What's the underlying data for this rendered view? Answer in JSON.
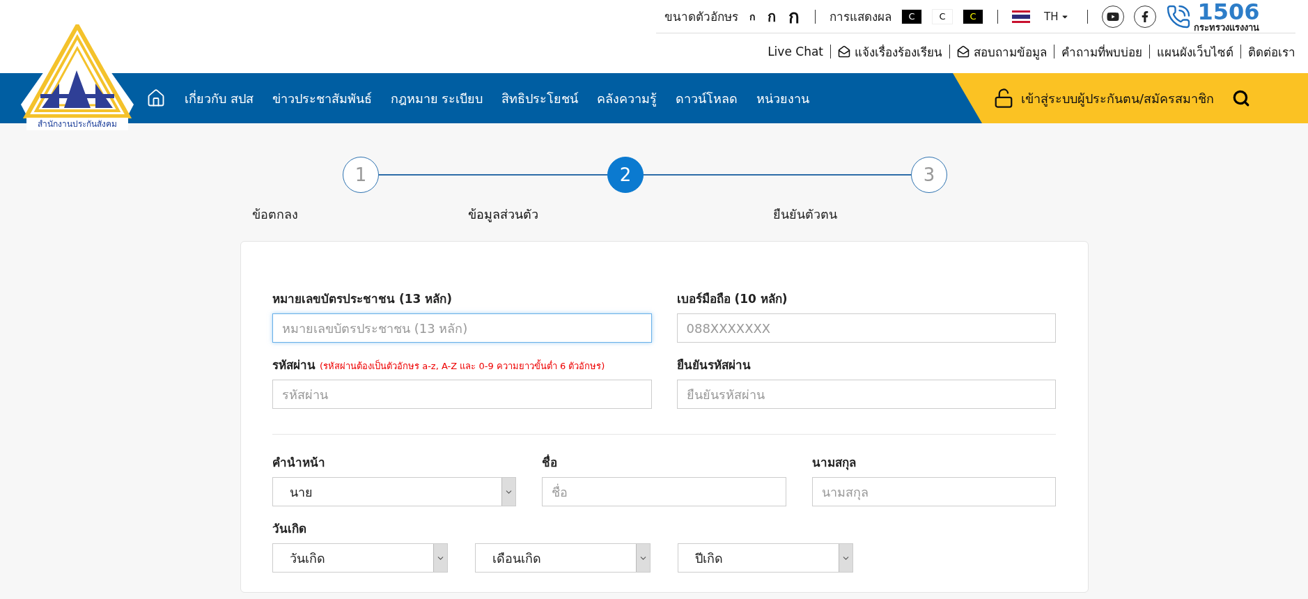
{
  "header": {
    "font_size": {
      "label": "ขนาดตัวอักษร",
      "options": [
        {
          "text": "ก",
          "kind": "small"
        },
        {
          "text": "ก",
          "kind": "medium"
        },
        {
          "text": "ก",
          "kind": "large"
        }
      ]
    },
    "display": {
      "label": "การแสดงผล",
      "options": [
        {
          "text": "C",
          "kind": "dark"
        },
        {
          "text": "C",
          "kind": "light"
        },
        {
          "text": "C",
          "kind": "yellow"
        }
      ]
    },
    "language": "TH",
    "hotline": {
      "number": "1506",
      "caption": "กระทรวงแรงงาน"
    },
    "links": [
      {
        "text": "Live Chat",
        "kind": "plain"
      },
      {
        "text": "แจ้งเรื่องร้องเรียน",
        "kind": "mail"
      },
      {
        "text": "สอบถามข้อมูล",
        "kind": "mail"
      },
      {
        "text": "คำถามที่พบบ่อย",
        "kind": "plain"
      },
      {
        "text": "แผนผังเว็บไซต์",
        "kind": "plain"
      },
      {
        "text": "ติดต่อเรา",
        "kind": "plain"
      }
    ]
  },
  "logo": {
    "caption": "สำนักงานประกันสังคม"
  },
  "nav": {
    "items": [
      "เกี่ยวกับ สปส",
      "ข่าวประชาสัมพันธ์",
      "กฎหมาย ระเบียบ",
      "สิทธิประโยชน์",
      "คลังความรู้",
      "ดาวน์โหลด",
      "หน่วยงาน"
    ],
    "login": "เข้าสู่ระบบผู้ประกันตน/สมัครสมาชิก"
  },
  "steps": [
    {
      "number": "1",
      "label": "ข้อตกลง",
      "selected": false
    },
    {
      "number": "2",
      "label": "ข้อมูลส่วนตัว",
      "selected": true
    },
    {
      "number": "3",
      "label": "ยืนยันตัวตน",
      "selected": false
    }
  ],
  "form": {
    "sections": [
      {
        "rows": [
          {
            "fields": [
              {
                "kind": "input",
                "label": "หมายเลขบัตรประชาชน (13 หลัก)",
                "placeholder": "หมายเลขบัตรประชาชน (13 หลัก)",
                "focused": true
              },
              {
                "kind": "input",
                "label": "เบอร์มือถือ (10 หลัก)",
                "placeholder": "088XXXXXXX",
                "focused": false
              }
            ]
          },
          {
            "fields": [
              {
                "kind": "input",
                "label": "รหัสผ่าน",
                "hint": "(รหัสผ่านต้องเป็นตัวอักษร a-z, A-Z และ 0-9 ความยาวขั้นต่ำ 6 ตัวอักษร)",
                "placeholder": "รหัสผ่าน",
                "focused": false
              },
              {
                "kind": "input",
                "label": "ยืนยันรหัสผ่าน",
                "placeholder": "ยืนยันรหัสผ่าน",
                "focused": false
              }
            ]
          }
        ]
      },
      {
        "rows": [
          {
            "fields": [
              {
                "kind": "select",
                "label": "คำนำหน้า",
                "value": "นาย"
              },
              {
                "kind": "input",
                "label": "ชื่อ",
                "placeholder": "ชื่อ",
                "focused": false
              },
              {
                "kind": "input",
                "label": "นามสกุล",
                "placeholder": "นามสกุล",
                "focused": false
              }
            ]
          },
          {
            "label": "วันเกิด",
            "fields": [
              {
                "kind": "select",
                "value": "วันเกิด"
              },
              {
                "kind": "select",
                "value": "เดือนเกิด"
              },
              {
                "kind": "select",
                "value": "ปีเกิด"
              }
            ]
          }
        ]
      }
    ]
  }
}
